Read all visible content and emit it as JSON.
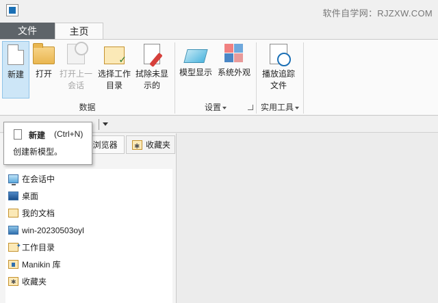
{
  "watermark": "软件自学网：RJZXW.COM",
  "tabs": {
    "file": "文件",
    "home": "主页"
  },
  "ribbon": {
    "groups": {
      "data": "数据",
      "settings": "设置",
      "tools": "实用工具"
    },
    "buttons": {
      "new": "新建",
      "open": "打开",
      "open_session_1": "打开上一",
      "open_session_2": "会话",
      "select_workdir_1": "选择工作",
      "select_workdir_2": "目录",
      "erase_1": "拭除未显",
      "erase_2": "示的",
      "model_display": "模型显示",
      "system_appearance": "系统外观",
      "play_trail_1": "播放追踪",
      "play_trail_2": "文件"
    }
  },
  "tooltip": {
    "title": "新建",
    "shortcut": "(Ctrl+N)",
    "description": "创建新模型。"
  },
  "panel": {
    "tabs": {
      "browser": "e浏览器",
      "favorites": "收藏夹"
    },
    "tree": [
      {
        "label": "在会话中",
        "icon": "monitor-icon"
      },
      {
        "label": "桌面",
        "icon": "desktop-icon"
      },
      {
        "label": "我的文档",
        "icon": "documents-icon"
      },
      {
        "label": "win-20230503oyl",
        "icon": "computer-icon"
      },
      {
        "label": "工作目录",
        "icon": "work-directory-icon"
      },
      {
        "label": "Manikin 库",
        "icon": "library-icon"
      },
      {
        "label": "收藏夹",
        "icon": "favorites-icon"
      }
    ]
  },
  "colors": {
    "file_tab": "#5e6469",
    "active_button": "#cde6f7",
    "ribbon_bg": "#fafafa"
  }
}
